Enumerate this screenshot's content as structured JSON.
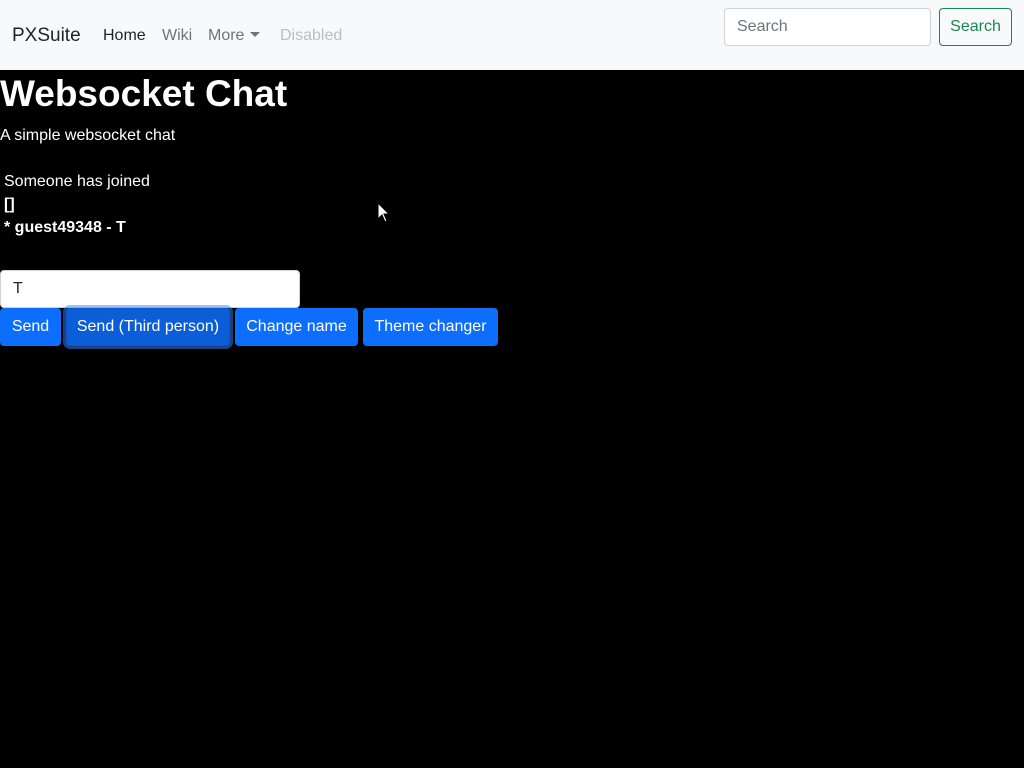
{
  "navbar": {
    "brand": "PXSuite",
    "links": [
      {
        "label": "Home"
      },
      {
        "label": "Wiki"
      },
      {
        "label": "More"
      },
      {
        "label": "Disabled"
      }
    ],
    "search_placeholder": "Search",
    "search_button": "Search"
  },
  "page": {
    "title": "Websocket Chat",
    "subtitle": "A simple websocket chat"
  },
  "messages": [
    "Someone has joined",
    "[]",
    "* guest49348 - T"
  ],
  "chat_input_value": "T",
  "buttons": {
    "send": "Send",
    "send_third_person": "Send (Third person)",
    "change_name": "Change name",
    "theme_changer": "Theme changer"
  },
  "colors": {
    "background": "#000000",
    "navbar": "#f8f9fa",
    "primary": "#0d6efd",
    "success": "#198754"
  }
}
